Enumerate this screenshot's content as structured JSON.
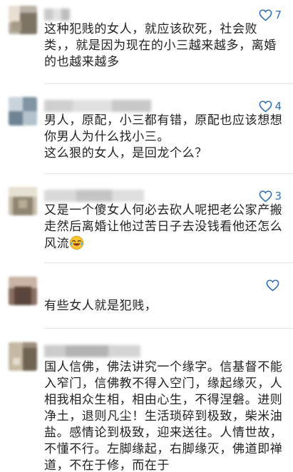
{
  "comments": [
    {
      "likes": "7",
      "text": "这种犯贱的女人，就应该砍死，社会败类，，就是因为现在的小三越来越多，离婚的也越来越多"
    },
    {
      "likes": "4",
      "text_lines": [
        "男人，原配，小三都有错，原配也应该想想你男人为什么找小三。",
        "这么狠的女人，是回龙个么？"
      ]
    },
    {
      "likes": "3",
      "text": "又是一个傻女人何必去砍人呢把老公家产搬走然后离婚让他过苦日子去没钱看他还怎么风流",
      "emoji": "laughing-crying-emoji"
    },
    {
      "likes": "",
      "text": "有些女人就是犯贱，"
    },
    {
      "likes": "",
      "text": "国人信佛，佛法讲究一个缘字。信基督不能入窄门，信佛教不得入空门，缘起缘灭，人相我相众生相，相由心生，不得涅磐。进则净土，退则凡尘！生活琐碎到极致，柴米油盐。感情论到极致，迎来送往。人情世故，不懂不行。左脚缘起，右脚缘灭，佛道即禅道，不在于修，而在于"
    }
  ],
  "colors": {
    "like": "#2f6fb3",
    "text": "#222222",
    "divider": "#e3e3e3"
  }
}
